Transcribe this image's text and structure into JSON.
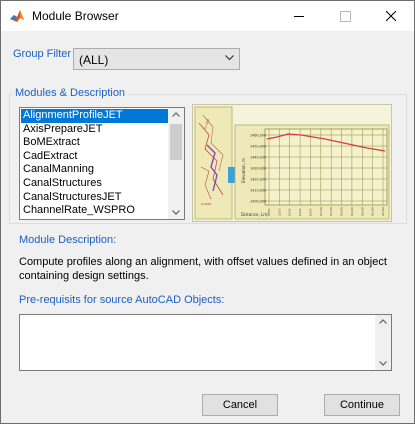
{
  "window": {
    "title": "Module Browser",
    "icon": "matlab-icon"
  },
  "group_filter": {
    "label": "Group Filter",
    "value": "(ALL)"
  },
  "modules": {
    "label": "Modules & Description",
    "items": [
      {
        "label": "AlignmentProfileJET",
        "selected": true
      },
      {
        "label": "AxisPrepareJET",
        "selected": false
      },
      {
        "label": "BoMExtract",
        "selected": false
      },
      {
        "label": "CadExtract",
        "selected": false
      },
      {
        "label": "CanalManning",
        "selected": false
      },
      {
        "label": "CanalStructures",
        "selected": false
      },
      {
        "label": "CanalStructuresJET",
        "selected": false
      },
      {
        "label": "ChannelRate_WSPRO",
        "selected": false
      }
    ],
    "preview": {
      "y_axis_label": "Elevation, m",
      "x_axis_label": "Distance, Lm)",
      "y_ticks": [
        "1460,000",
        "1450,000",
        "1440,000",
        "1430,000",
        "1420,000",
        "1410,000",
        "1400,000"
      ],
      "x_ticks": [
        "0,000",
        "2,000",
        "4,000",
        "6,000",
        "8,000",
        "10,000",
        "12,000",
        "14,000",
        "16,000",
        "18,000",
        "20,000",
        "22,000"
      ],
      "map_labels": [
        "0+200",
        "0+000"
      ],
      "colors": {
        "profile": "#d23c3c",
        "arrow": "#3aa3d8",
        "grid": "#6d7a24",
        "background": "#f5f3d9"
      }
    }
  },
  "description": {
    "label": "Module Description:",
    "text": "Compute profiles along an alignment, with offset values defined in an object containing design settings."
  },
  "prereq": {
    "label": "Pre-requisits for source AutoCAD Objects:",
    "value": ""
  },
  "buttons": {
    "cancel": "Cancel",
    "continue": "Continue"
  },
  "colors": {
    "accent_label": "#1a5fc4",
    "selection": "#0078d7"
  }
}
